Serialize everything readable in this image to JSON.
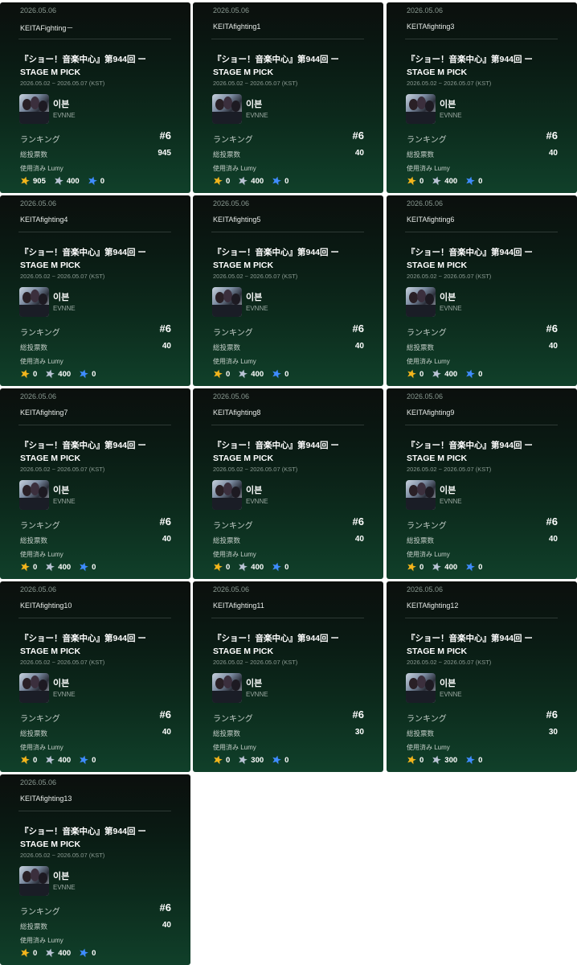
{
  "colors": {
    "gold_star": "#f3b51c",
    "silver_star": "#b9c3d4",
    "blue_star": "#3f8cff"
  },
  "icons": {
    "gold": "gold-lumy-icon",
    "silver": "silver-lumy-icon",
    "blue": "blue-lumy-icon"
  },
  "cards": [
    {
      "date": "2026.05.06",
      "user": "KEITAFighting－",
      "title": "『ショー！音楽中心』第944回 ー STAGE M PICK",
      "period": "2026.05.02 ~ 2026.05.07 (KST)",
      "artist": "이븐",
      "group": "EVNNE",
      "rank_label": "ランキング",
      "rank": "#6",
      "votes_label": "総投票数",
      "votes": "945",
      "lumy_label": "使用済み Lumy",
      "gold": "905",
      "silver": "400",
      "blue": "0"
    },
    {
      "date": "2026.05.06",
      "user": "KEITAfighting1",
      "title": "『ショー！音楽中心』第944回 ー STAGE M PICK",
      "period": "2026.05.02 ~ 2026.05.07 (KST)",
      "artist": "이븐",
      "group": "EVNNE",
      "rank_label": "ランキング",
      "rank": "#6",
      "votes_label": "総投票数",
      "votes": "40",
      "lumy_label": "使用済み Lumy",
      "gold": "0",
      "silver": "400",
      "blue": "0"
    },
    {
      "date": "2026.05.06",
      "user": "KEITAfighting3",
      "title": "『ショー！音楽中心』第944回 ー STAGE M PICK",
      "period": "2026.05.02 ~ 2026.05.07 (KST)",
      "artist": "이븐",
      "group": "EVNNE",
      "rank_label": "ランキング",
      "rank": "#6",
      "votes_label": "総投票数",
      "votes": "40",
      "lumy_label": "使用済み Lumy",
      "gold": "0",
      "silver": "400",
      "blue": "0"
    },
    {
      "date": "2026.05.06",
      "user": "KEITAfighting4",
      "title": "『ショー！音楽中心』第944回 ー STAGE M PICK",
      "period": "2026.05.02 ~ 2026.05.07 (KST)",
      "artist": "이븐",
      "group": "EVNNE",
      "rank_label": "ランキング",
      "rank": "#6",
      "votes_label": "総投票数",
      "votes": "40",
      "lumy_label": "使用済み Lumy",
      "gold": "0",
      "silver": "400",
      "blue": "0"
    },
    {
      "date": "2026.05.06",
      "user": "KEITAfighting5",
      "title": "『ショー！音楽中心』第944回 ー STAGE M PICK",
      "period": "2026.05.02 ~ 2026.05.07 (KST)",
      "artist": "이븐",
      "group": "EVNNE",
      "rank_label": "ランキング",
      "rank": "#6",
      "votes_label": "総投票数",
      "votes": "40",
      "lumy_label": "使用済み Lumy",
      "gold": "0",
      "silver": "400",
      "blue": "0"
    },
    {
      "date": "2026.05.06",
      "user": "KEITAfighting6",
      "title": "『ショー！音楽中心』第944回 ー STAGE M PICK",
      "period": "2026.05.02 ~ 2026.05.07 (KST)",
      "artist": "이븐",
      "group": "EVNNE",
      "rank_label": "ランキング",
      "rank": "#6",
      "votes_label": "総投票数",
      "votes": "40",
      "lumy_label": "使用済み Lumy",
      "gold": "0",
      "silver": "400",
      "blue": "0"
    },
    {
      "date": "2026.05.06",
      "user": "KEITAfighting7",
      "title": "『ショー！音楽中心』第944回 ー STAGE M PICK",
      "period": "2026.05.02 ~ 2026.05.07 (KST)",
      "artist": "이븐",
      "group": "EVNNE",
      "rank_label": "ランキング",
      "rank": "#6",
      "votes_label": "総投票数",
      "votes": "40",
      "lumy_label": "使用済み Lumy",
      "gold": "0",
      "silver": "400",
      "blue": "0"
    },
    {
      "date": "2026.05.06",
      "user": "KEITAfighting8",
      "title": "『ショー！音楽中心』第944回 ー STAGE M PICK",
      "period": "2026.05.02 ~ 2026.05.07 (KST)",
      "artist": "이븐",
      "group": "EVNNE",
      "rank_label": "ランキング",
      "rank": "#6",
      "votes_label": "総投票数",
      "votes": "40",
      "lumy_label": "使用済み Lumy",
      "gold": "0",
      "silver": "400",
      "blue": "0"
    },
    {
      "date": "2026.05.06",
      "user": "KEITAfighting9",
      "title": "『ショー！音楽中心』第944回 ー STAGE M PICK",
      "period": "2026.05.02 ~ 2026.05.07 (KST)",
      "artist": "이븐",
      "group": "EVNNE",
      "rank_label": "ランキング",
      "rank": "#6",
      "votes_label": "総投票数",
      "votes": "40",
      "lumy_label": "使用済み Lumy",
      "gold": "0",
      "silver": "400",
      "blue": "0"
    },
    {
      "date": "2026.05.06",
      "user": "KEITAfighting10",
      "title": "『ショー！音楽中心』第944回 ー STAGE M PICK",
      "period": "2026.05.02 ~ 2026.05.07 (KST)",
      "artist": "이븐",
      "group": "EVNNE",
      "rank_label": "ランキング",
      "rank": "#6",
      "votes_label": "総投票数",
      "votes": "40",
      "lumy_label": "使用済み Lumy",
      "gold": "0",
      "silver": "400",
      "blue": "0"
    },
    {
      "date": "2026.05.06",
      "user": "KEITAfighting11",
      "title": "『ショー！音楽中心』第944回 ー STAGE M PICK",
      "period": "2026.05.02 ~ 2026.05.07 (KST)",
      "artist": "이븐",
      "group": "EVNNE",
      "rank_label": "ランキング",
      "rank": "#6",
      "votes_label": "総投票数",
      "votes": "30",
      "lumy_label": "使用済み Lumy",
      "gold": "0",
      "silver": "300",
      "blue": "0"
    },
    {
      "date": "2026.05.06",
      "user": "KEITAfighting12",
      "title": "『ショー！音楽中心』第944回 ー STAGE M PICK",
      "period": "2026.05.02 ~ 2026.05.07 (KST)",
      "artist": "이븐",
      "group": "EVNNE",
      "rank_label": "ランキング",
      "rank": "#6",
      "votes_label": "総投票数",
      "votes": "30",
      "lumy_label": "使用済み Lumy",
      "gold": "0",
      "silver": "300",
      "blue": "0"
    },
    {
      "date": "2026.05.06",
      "user": "KEITAfighting13",
      "title": "『ショー！音楽中心』第944回 ー STAGE M PICK",
      "period": "2026.05.02 ~ 2026.05.07 (KST)",
      "artist": "이븐",
      "group": "EVNNE",
      "rank_label": "ランキング",
      "rank": "#6",
      "votes_label": "総投票数",
      "votes": "40",
      "lumy_label": "使用済み Lumy",
      "gold": "0",
      "silver": "400",
      "blue": "0"
    }
  ]
}
